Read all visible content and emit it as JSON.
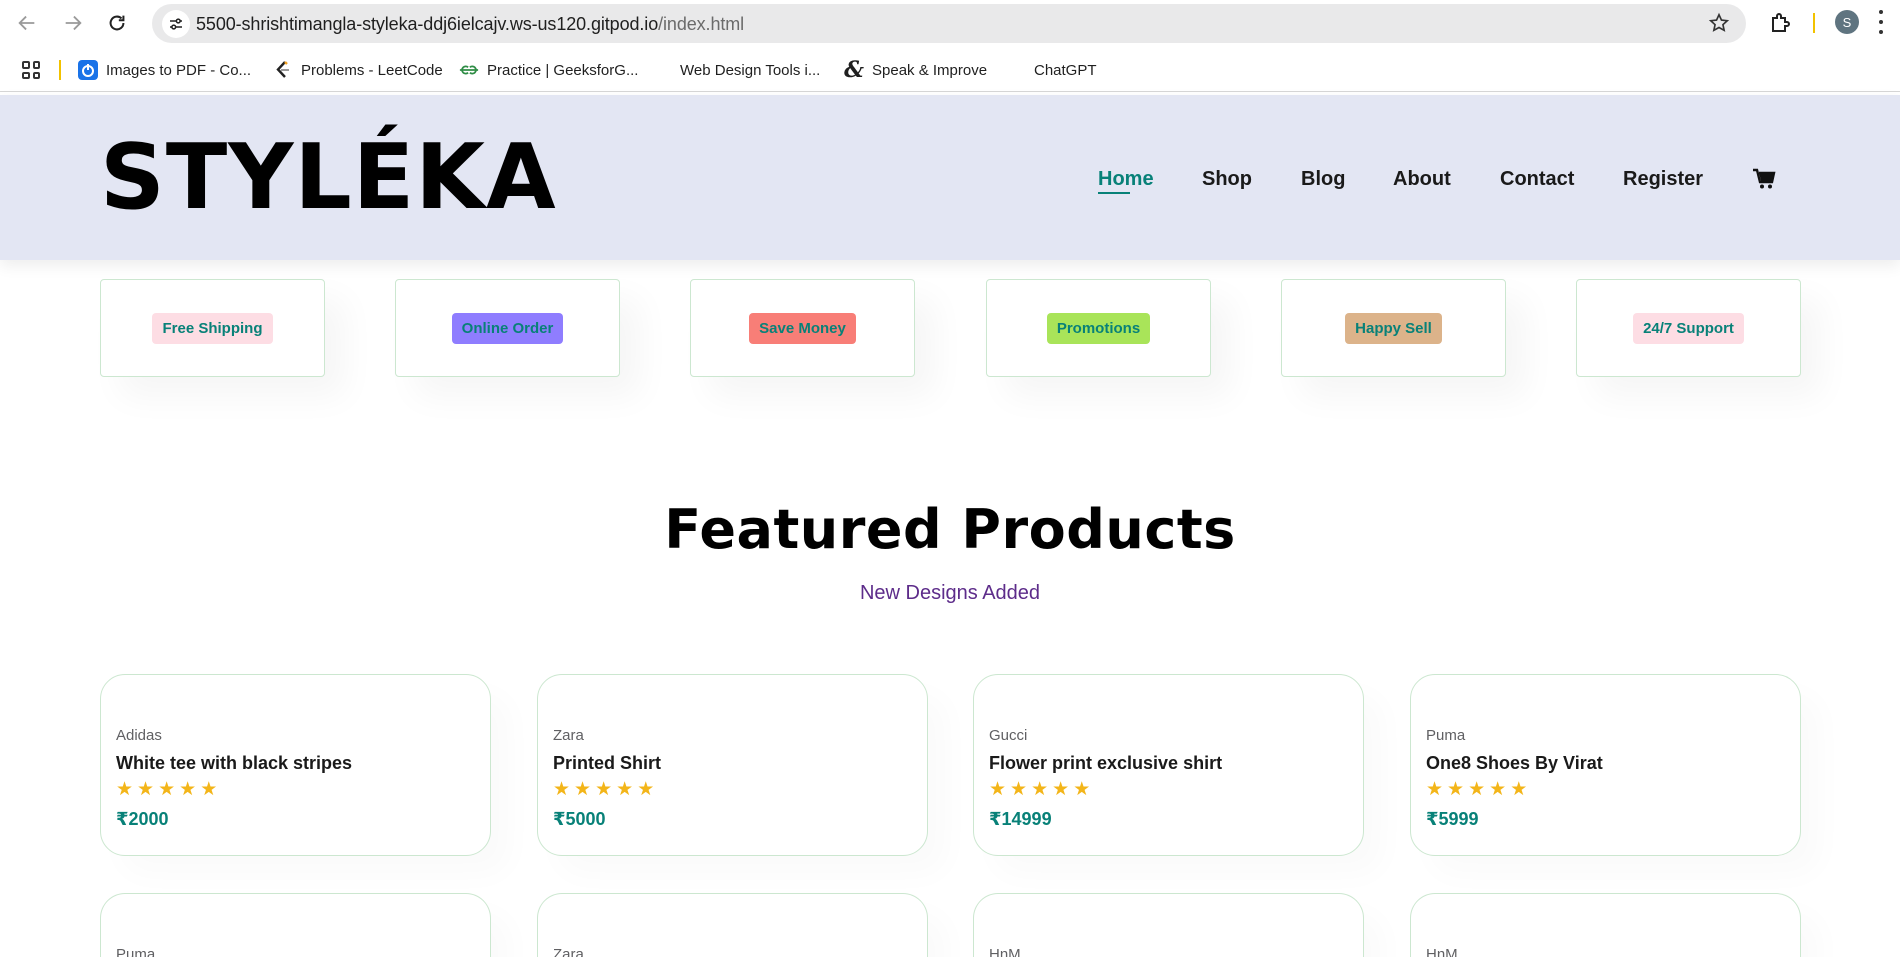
{
  "browser": {
    "url_host": "5500-shrishtimangla-styleka-ddj6ielcajv.ws-us120.gitpod.io",
    "url_path": "/index.html",
    "profile_initial": "S"
  },
  "bookmarks": [
    {
      "label": "Images to PDF - Co...",
      "icon": "power-icon"
    },
    {
      "label": "Problems - LeetCode",
      "icon": "leetcode-icon"
    },
    {
      "label": "Practice | GeeksforG...",
      "icon": "geeksforgeeks-icon"
    },
    {
      "label": "Web Design Tools i...",
      "icon": "none"
    },
    {
      "label": "Speak & Improve",
      "icon": "ampersand-icon"
    },
    {
      "label": "ChatGPT",
      "icon": "none"
    }
  ],
  "site": {
    "logo": "STYLÉKA",
    "nav": [
      {
        "label": "Home",
        "active": true
      },
      {
        "label": "Shop",
        "active": false
      },
      {
        "label": "Blog",
        "active": false
      },
      {
        "label": "About",
        "active": false
      },
      {
        "label": "Contact",
        "active": false
      },
      {
        "label": "Register",
        "active": false
      }
    ],
    "cart_icon": "cart-icon",
    "accent_color": "#088178"
  },
  "features": [
    {
      "label": "Free Shipping",
      "bg": "#fddde4"
    },
    {
      "label": "Online Order",
      "bg": "#8f7dff"
    },
    {
      "label": "Save Money",
      "bg": "#f87e77"
    },
    {
      "label": "Promotions",
      "bg": "#a9e459"
    },
    {
      "label": "Happy Sell",
      "bg": "#dcb38a"
    },
    {
      "label": "24/7 Support",
      "bg": "#fddde4"
    }
  ],
  "featured": {
    "title": "Featured Products",
    "subtitle": "New Designs Added"
  },
  "products": [
    {
      "brand": "Adidas",
      "name": "White tee with black stripes",
      "rating": 5,
      "price": "₹2000"
    },
    {
      "brand": "Zara",
      "name": "Printed Shirt",
      "rating": 5,
      "price": "₹5000"
    },
    {
      "brand": "Gucci",
      "name": "Flower print exclusive shirt",
      "rating": 5,
      "price": "₹14999"
    },
    {
      "brand": "Puma",
      "name": "One8 Shoes By Virat",
      "rating": 5,
      "price": "₹5999"
    }
  ],
  "products_row2_brands": [
    "Puma",
    "Zara",
    "HnM",
    "HnM"
  ]
}
